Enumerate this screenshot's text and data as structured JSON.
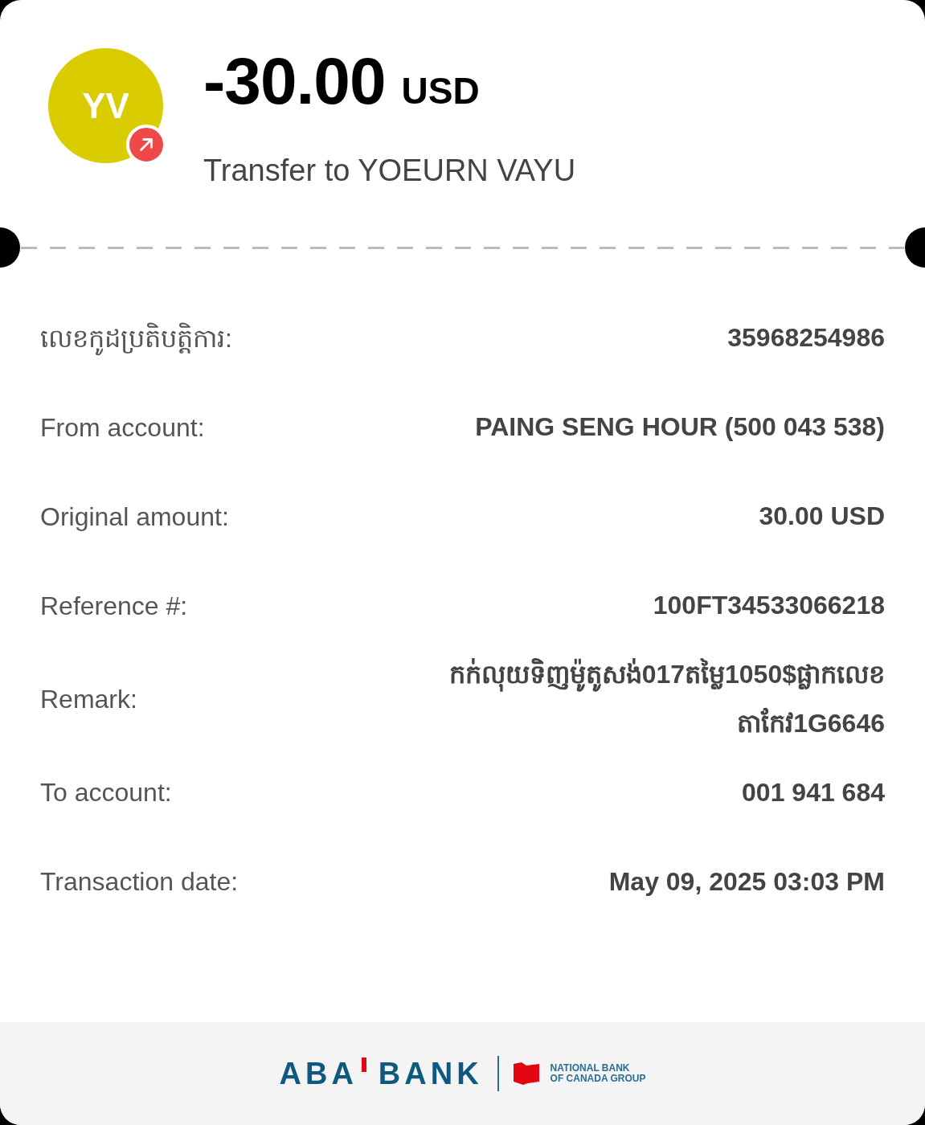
{
  "header": {
    "avatar": {
      "initials": "YV",
      "color": "#d9cc00",
      "outgoing": true
    },
    "amount": "-30.00",
    "currency": "USD",
    "description": "Transfer to YOEURN VAYU"
  },
  "details": [
    {
      "label": "លេខកូដប្រតិបត្តិការ:",
      "value": "35968254986"
    },
    {
      "label": "From account:",
      "value": "PAING SENG HOUR (500 043 538)"
    },
    {
      "label": "Original amount:",
      "value": "30.00 USD"
    },
    {
      "label": "Reference #:",
      "value": "100FT34533066218"
    },
    {
      "label": "Remark:",
      "value": "កក់លុយទិញម៉ូតូសង់017តម្លៃ1050$ផ្លាកលេខតាកែវ1G6646"
    },
    {
      "label": "To account:",
      "value": "001 941 684"
    },
    {
      "label": "Transaction date:",
      "value": "May 09, 2025 03:03 PM"
    }
  ],
  "footer": {
    "logo_left": "ABA",
    "logo_right": "BANK",
    "group_line_1": "NATIONAL BANK",
    "group_line_2": "OF CANADA GROUP"
  }
}
